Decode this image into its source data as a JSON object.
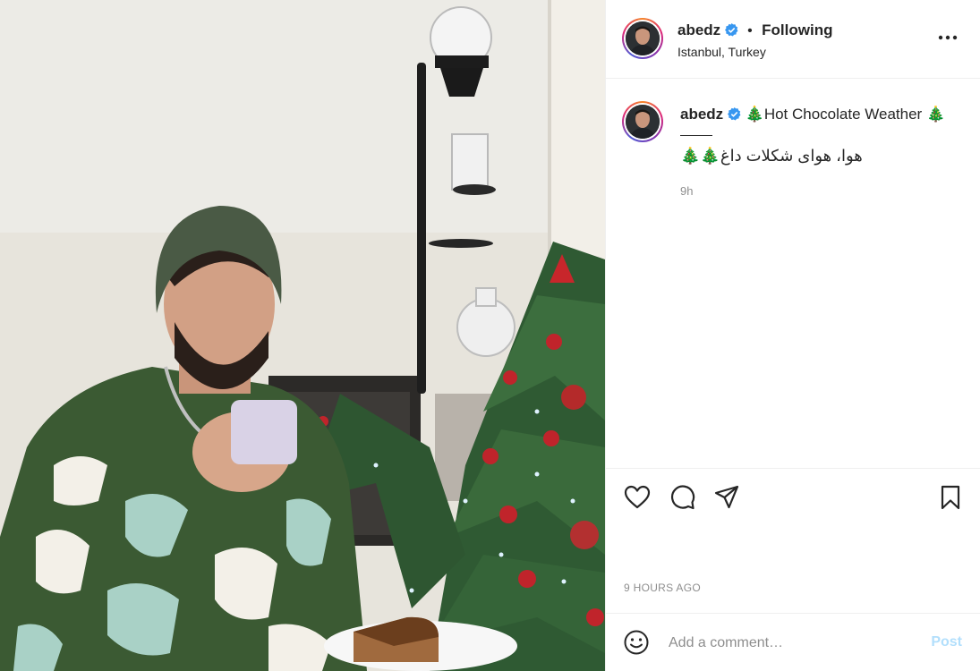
{
  "header": {
    "username": "abedz",
    "separator": "•",
    "follow_status": "Following",
    "location": "Istanbul, Turkey",
    "more_icon": "more-horizontal-icon"
  },
  "caption": {
    "username": "abedz",
    "title": "🎄Hot Chocolate Weather 🎄",
    "persian_line": "هوا، هوای شکلات داغ🎄🎄",
    "time": "9h"
  },
  "actions": {
    "like_icon": "heart-icon",
    "comment_icon": "comment-bubble-icon",
    "share_icon": "paper-plane-icon",
    "save_icon": "bookmark-icon",
    "timestamp": "9 HOURS AGO"
  },
  "comment_box": {
    "emoji_icon": "smiley-icon",
    "placeholder": "Add a comment…",
    "value": "",
    "post_label": "Post"
  },
  "colors": {
    "verified": "#3897f0",
    "post_disabled": "#b2dffc",
    "secondary_text": "#8e8e8e",
    "primary_text": "#262626"
  }
}
